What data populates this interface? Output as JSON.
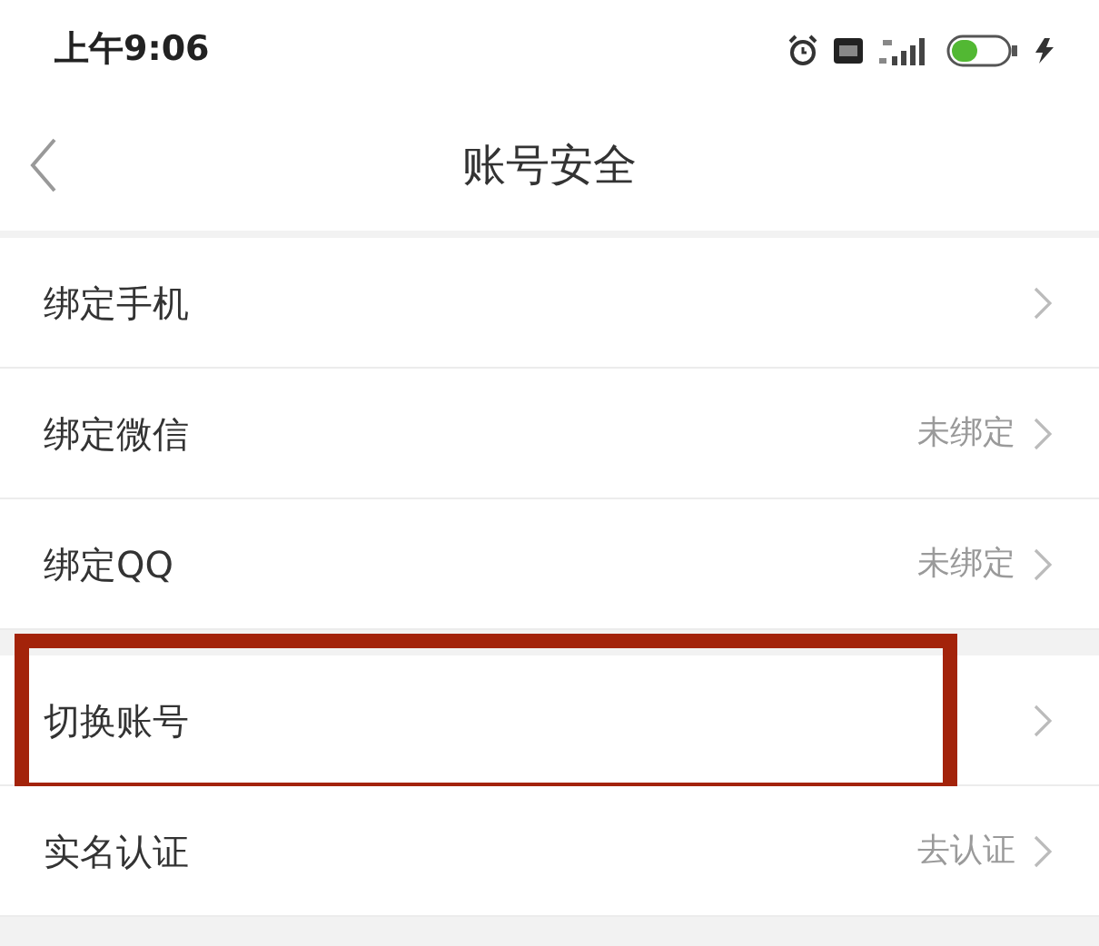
{
  "status_bar": {
    "time": "上午9:06"
  },
  "header": {
    "title": "账号安全"
  },
  "items": [
    {
      "label": "绑定手机",
      "highlighted": false,
      "gap_before": false
    },
    {
      "label": "绑定微信",
      "value": "未绑定",
      "highlighted": false,
      "gap_before": false
    },
    {
      "label": "绑定QQ",
      "value": "未绑定",
      "highlighted": false,
      "gap_before": false
    },
    {
      "label": "切换账号",
      "highlighted": true,
      "gap_before": true
    },
    {
      "label": "实名认证",
      "value": "去认证",
      "highlighted": false,
      "gap_before": false
    }
  ]
}
